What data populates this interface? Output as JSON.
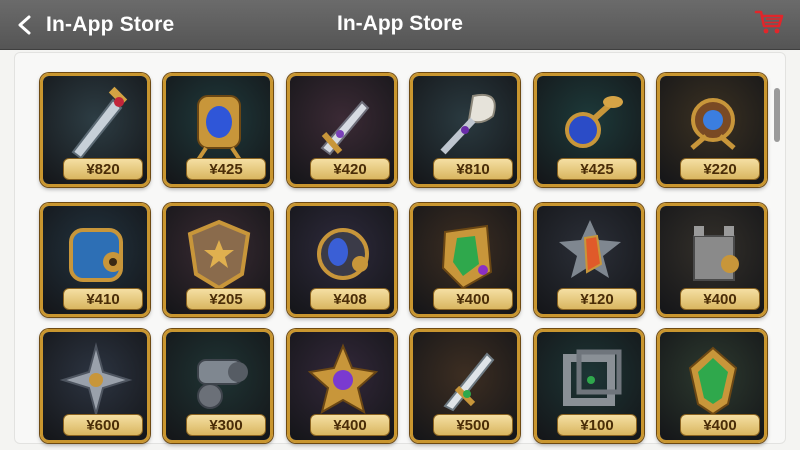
{
  "header": {
    "back_label": "In-App Store",
    "title": "In-App Store",
    "colors": {
      "bar": "#5f5f5f",
      "text": "#ffffff",
      "cart": "#e0262b"
    }
  },
  "items": [
    {
      "price": "¥820",
      "icon": "sword-icon",
      "bg": "#2d3d44"
    },
    {
      "price": "¥425",
      "icon": "amulet-icon",
      "bg": "#1f3a3c"
    },
    {
      "price": "¥420",
      "icon": "dagger-icon",
      "bg": "#3b2a35"
    },
    {
      "price": "¥810",
      "icon": "feather-dagger-icon",
      "bg": "#2a3a40"
    },
    {
      "price": "¥425",
      "icon": "orb-staff-icon",
      "bg": "#1d3a3a"
    },
    {
      "price": "¥220",
      "icon": "crest-icon",
      "bg": "#3b3122"
    },
    {
      "price": "¥410",
      "icon": "chest-armor-icon",
      "bg": "#22333f"
    },
    {
      "price": "¥205",
      "icon": "star-shield-icon",
      "bg": "#3a2b33"
    },
    {
      "price": "¥408",
      "icon": "gem-orb-icon",
      "bg": "#2e2a3c"
    },
    {
      "price": "¥400",
      "icon": "gem-shield-icon",
      "bg": "#3d2e22"
    },
    {
      "price": "¥120",
      "icon": "spiked-gem-icon",
      "bg": "#2b2f38"
    },
    {
      "price": "¥400",
      "icon": "tower-icon",
      "bg": "#34302a"
    },
    {
      "price": "¥600",
      "icon": "shuriken-icon",
      "bg": "#2c3441"
    },
    {
      "price": "¥300",
      "icon": "cannon-icon",
      "bg": "#1f3434"
    },
    {
      "price": "¥400",
      "icon": "star-gem-icon",
      "bg": "#33283a"
    },
    {
      "price": "¥500",
      "icon": "green-sword-icon",
      "bg": "#3d2e22"
    },
    {
      "price": "¥100",
      "icon": "cube-frame-icon",
      "bg": "#1d3535"
    },
    {
      "price": "¥400",
      "icon": "green-gem-icon",
      "bg": "#2d3a2f"
    }
  ]
}
